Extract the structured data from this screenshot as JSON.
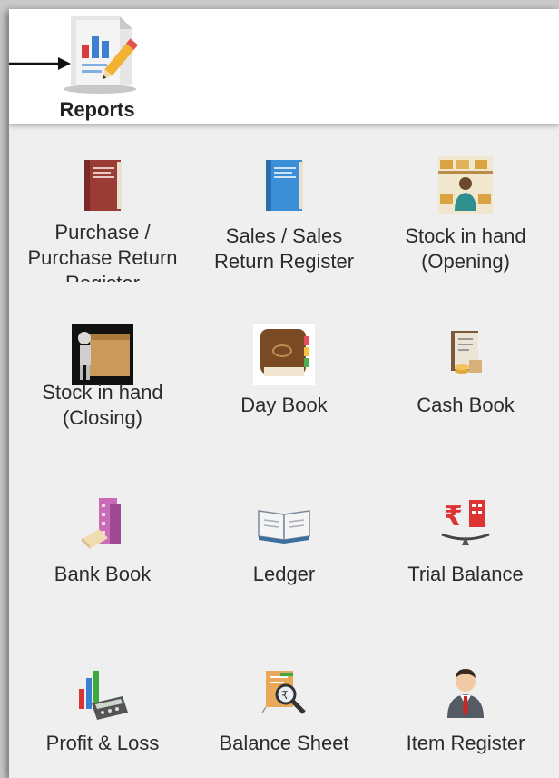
{
  "header": {
    "title": "Reports",
    "icon": "reports-icon"
  },
  "grid": {
    "items": [
      {
        "label": "Purchase / Purchase Return Register",
        "icon": "purchase-book-icon"
      },
      {
        "label": "Sales / Sales Return Register",
        "icon": "sales-book-icon"
      },
      {
        "label": "Stock in hand (Opening)",
        "icon": "warehouse-person-icon"
      },
      {
        "label": "Stock in hand (Closing)",
        "icon": "box-carrier-icon"
      },
      {
        "label": "Day Book",
        "icon": "diary-icon"
      },
      {
        "label": "Cash Book",
        "icon": "cash-ledger-icon"
      },
      {
        "label": "Bank Book",
        "icon": "bank-building-icon"
      },
      {
        "label": "Ledger",
        "icon": "open-book-icon"
      },
      {
        "label": "Trial Balance",
        "icon": "rupee-scale-icon"
      },
      {
        "label": "Profit & Loss",
        "icon": "calculator-chart-icon"
      },
      {
        "label": "Balance Sheet",
        "icon": "magnifier-report-icon"
      },
      {
        "label": "Item Register",
        "icon": "businessman-icon"
      }
    ]
  }
}
